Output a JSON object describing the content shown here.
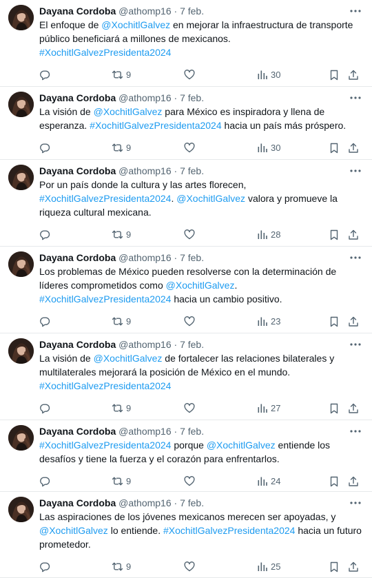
{
  "tweets": [
    {
      "name": "Dayana Cordoba",
      "handle": "@athomp16",
      "sep": "·",
      "time": "7 feb.",
      "lines": [
        [
          {
            "t": "El enfoque de "
          },
          {
            "t": "@XochitlGalvez",
            "link": true
          },
          {
            "t": " en mejorar la infraestructura de transporte"
          }
        ],
        [
          {
            "t": "público beneficiará a millones de mexicanos."
          }
        ],
        [
          {
            "t": "#XochitlGalvezPresidenta2024",
            "link": true
          }
        ]
      ],
      "retweets": "9",
      "views": "30"
    },
    {
      "name": "Dayana Cordoba",
      "handle": "@athomp16",
      "sep": "·",
      "time": "7 feb.",
      "lines": [
        [
          {
            "t": "La visión de "
          },
          {
            "t": "@XochitlGalvez",
            "link": true
          },
          {
            "t": " para México es inspiradora y llena de"
          }
        ],
        [
          {
            "t": "esperanza. "
          },
          {
            "t": "#XochitlGalvezPresidenta2024",
            "link": true
          },
          {
            "t": " hacia un país más próspero."
          }
        ]
      ],
      "retweets": "9",
      "views": "30"
    },
    {
      "name": "Dayana Cordoba",
      "handle": "@athomp16",
      "sep": "·",
      "time": "7 feb.",
      "lines": [
        [
          {
            "t": "Por un país donde la cultura y las artes florecen,"
          }
        ],
        [
          {
            "t": "#XochitlGalvezPresidenta2024",
            "link": true
          },
          {
            "t": ". "
          },
          {
            "t": "@XochitlGalvez",
            "link": true
          },
          {
            "t": " valora y promueve la"
          }
        ],
        [
          {
            "t": "riqueza cultural mexicana."
          }
        ]
      ],
      "retweets": "9",
      "views": "28"
    },
    {
      "name": "Dayana Cordoba",
      "handle": "@athomp16",
      "sep": "·",
      "time": "7 feb.",
      "lines": [
        [
          {
            "t": "Los problemas de México pueden resolverse con la determinación de"
          }
        ],
        [
          {
            "t": "líderes comprometidos como "
          },
          {
            "t": "@XochitlGalvez",
            "link": true
          },
          {
            "t": "."
          }
        ],
        [
          {
            "t": "#XochitlGalvezPresidenta2024",
            "link": true
          },
          {
            "t": " hacia un cambio positivo."
          }
        ]
      ],
      "retweets": "9",
      "views": "23"
    },
    {
      "name": "Dayana Cordoba",
      "handle": "@athomp16",
      "sep": "·",
      "time": "7 feb.",
      "lines": [
        [
          {
            "t": "La visión de "
          },
          {
            "t": "@XochitlGalvez",
            "link": true
          },
          {
            "t": " de fortalecer las relaciones bilaterales y"
          }
        ],
        [
          {
            "t": "multilaterales mejorará la posición de México en el mundo."
          }
        ],
        [
          {
            "t": "#XochitlGalvezPresidenta2024",
            "link": true
          }
        ]
      ],
      "retweets": "9",
      "views": "27"
    },
    {
      "name": "Dayana Cordoba",
      "handle": "@athomp16",
      "sep": "·",
      "time": "7 feb.",
      "lines": [
        [
          {
            "t": "#XochitlGalvezPresidenta2024",
            "link": true
          },
          {
            "t": " porque "
          },
          {
            "t": "@XochitlGalvez",
            "link": true
          },
          {
            "t": " entiende los"
          }
        ],
        [
          {
            "t": "desafíos y tiene la fuerza y el corazón para enfrentarlos."
          }
        ]
      ],
      "retweets": "9",
      "views": "24"
    },
    {
      "name": "Dayana Cordoba",
      "handle": "@athomp16",
      "sep": "·",
      "time": "7 feb.",
      "lines": [
        [
          {
            "t": "Las aspiraciones de los jóvenes mexicanos merecen ser apoyadas, y"
          }
        ],
        [
          {
            "t": "@XochitlGalvez",
            "link": true
          },
          {
            "t": " lo entiende. "
          },
          {
            "t": "#XochitlGalvezPresidenta2024",
            "link": true
          },
          {
            "t": " hacia un futuro"
          }
        ],
        [
          {
            "t": "prometedor."
          }
        ]
      ],
      "retweets": "9",
      "views": "25"
    }
  ],
  "icons": {
    "reply": "reply-icon",
    "retweet": "retweet-icon",
    "like": "heart-icon",
    "views": "views-icon",
    "bookmark": "bookmark-icon",
    "share": "share-icon",
    "more": "more-icon"
  },
  "colors": {
    "text": "#0f1419",
    "muted": "#536471",
    "link": "#1d9bf0",
    "divider": "#e6e9eb"
  }
}
